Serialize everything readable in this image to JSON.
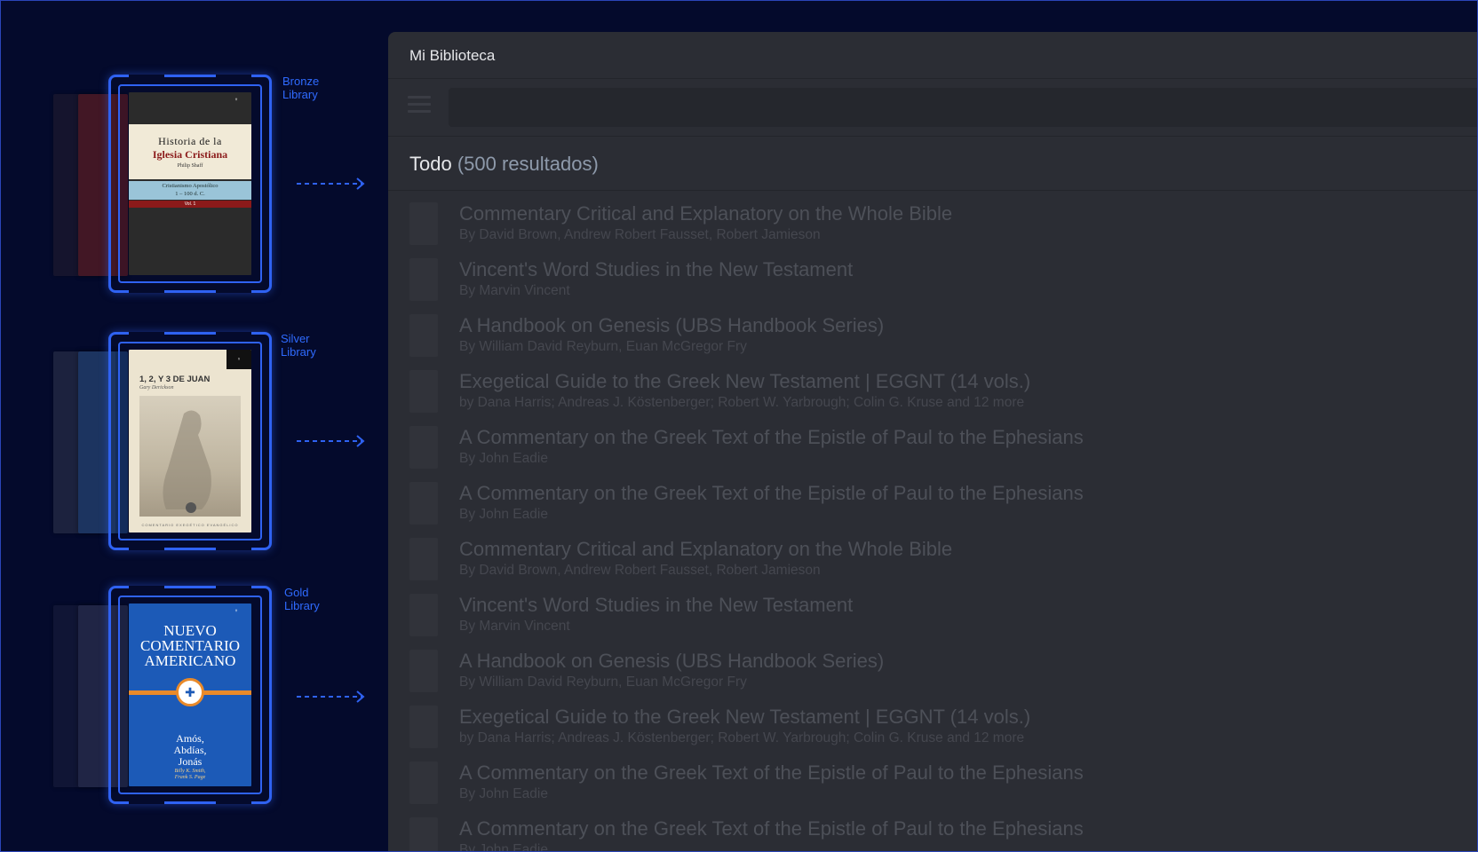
{
  "tiers": [
    {
      "label_line1": "Bronze",
      "label_line2": "Library",
      "cover": {
        "title_line1": "Historia de la",
        "title_line2": "Iglesia Cristiana",
        "author": "Philip Shaff",
        "band_line1": "Cristianismo Apostólico",
        "band_line2": "1 – 100 d. C.",
        "volume": "Vol. 1"
      }
    },
    {
      "label_line1": "Silver",
      "label_line2": "Library",
      "cover": {
        "title": "1, 2, Y 3 DE JUAN",
        "author": "Gary Derickson",
        "footer": "COMENTARIO EXEGÉTICO EVANGÉLICO"
      }
    },
    {
      "label_line1": "Gold",
      "label_line2": "Library",
      "cover": {
        "title_line1": "NUEVO",
        "title_line2": "COMENTARIO",
        "title_line3": "AMERICANO",
        "books_line1": "Amós,",
        "books_line2": "Abdías,",
        "books_line3": "Jonás",
        "authors_line1": "Billy K. Smith,",
        "authors_line2": "Frank S. Page"
      }
    }
  ],
  "window": {
    "title": "Mi Biblioteca",
    "search": {
      "value": "",
      "placeholder": ""
    },
    "section": {
      "label": "Todo",
      "count": "(500 resultados)"
    },
    "results": [
      {
        "title": "Commentary Critical and Explanatory on the Whole Bible",
        "author": "By David Brown, Andrew Robert Fausset, Robert Jamieson"
      },
      {
        "title": "Vincent's Word Studies in the New Testament",
        "author": "By Marvin Vincent"
      },
      {
        "title": "A Handbook on Genesis (UBS Handbook Series)",
        "author": "By William David Reyburn, Euan McGregor Fry"
      },
      {
        "title": "Exegetical Guide to the Greek New Testament | EGGNT (14 vols.)",
        "author": "by Dana Harris; Andreas J. Köstenberger; Robert W. Yarbrough; Colin G. Kruse and 12 more"
      },
      {
        "title": "A Commentary on the Greek Text of the Epistle of Paul to the Ephesians",
        "author": "By John Eadie"
      },
      {
        "title": "A Commentary on the Greek Text of the Epistle of Paul to the Ephesians",
        "author": "By John Eadie"
      },
      {
        "title": "Commentary Critical and Explanatory on the Whole Bible",
        "author": "By David Brown, Andrew Robert Fausset, Robert Jamieson"
      },
      {
        "title": "Vincent's Word Studies in the New Testament",
        "author": "By Marvin Vincent"
      },
      {
        "title": "A Handbook on Genesis (UBS Handbook Series)",
        "author": "By William David Reyburn, Euan McGregor Fry"
      },
      {
        "title": "Exegetical Guide to the Greek New Testament | EGGNT (14 vols.)",
        "author": "by Dana Harris; Andreas J. Köstenberger; Robert W. Yarbrough; Colin G. Kruse and 12 more"
      },
      {
        "title": "A Commentary on the Greek Text of the Epistle of Paul to the Ephesians",
        "author": "By John Eadie"
      },
      {
        "title": "A Commentary on the Greek Text of the Epistle of Paul to the Ephesians",
        "author": "By John Eadie"
      }
    ]
  },
  "colors": {
    "background": "#040a2c",
    "accent_blue": "#2f62f2",
    "window_bg": "#2b2d34",
    "dim_text": "#4d5058"
  },
  "icons": {
    "menu": "hamburger-menu-icon",
    "arrow": "dashed-arrow-right-icon"
  }
}
